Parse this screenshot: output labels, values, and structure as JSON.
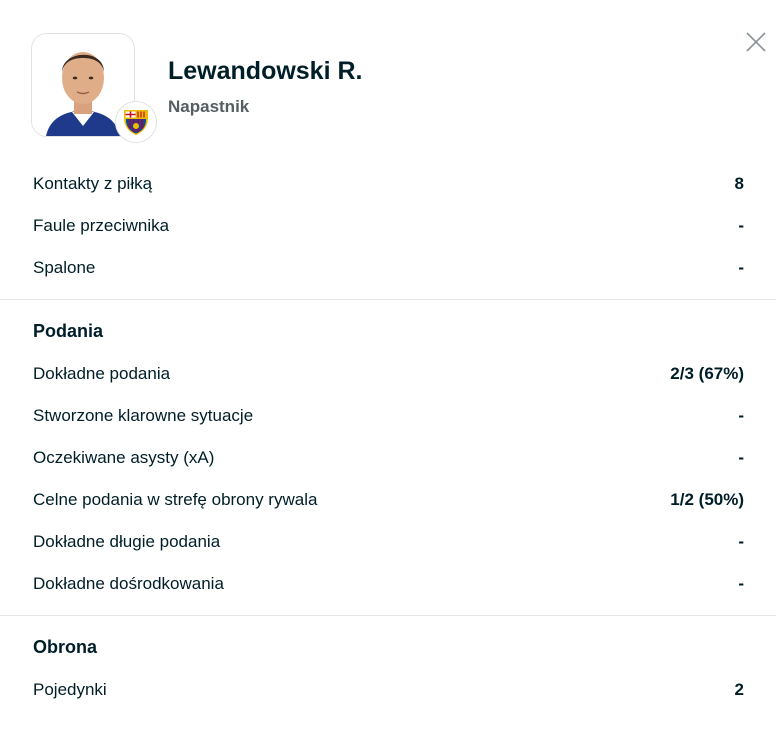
{
  "player": {
    "name": "Lewandowski R.",
    "position": "Napastnik",
    "club_badge_icon": "fc-barcelona-badge-icon"
  },
  "general": [
    {
      "label": "Kontakty z piłką",
      "value": "8"
    },
    {
      "label": "Faule przeciwnika",
      "value": "-"
    },
    {
      "label": "Spalone",
      "value": "-"
    }
  ],
  "passes": {
    "title": "Podania",
    "rows": [
      {
        "label": "Dokładne podania",
        "value": "2/3 (67%)"
      },
      {
        "label": "Stworzone klarowne sytuacje",
        "value": "-"
      },
      {
        "label": "Oczekiwane asysty (xA)",
        "value": "-"
      },
      {
        "label": "Celne podania w strefę obrony rywala",
        "value": "1/2 (50%)"
      },
      {
        "label": "Dokładne długie podania",
        "value": "-"
      },
      {
        "label": "Dokładne dośrodkowania",
        "value": "-"
      }
    ]
  },
  "defense": {
    "title": "Obrona",
    "rows": [
      {
        "label": "Pojedynki",
        "value": "2"
      }
    ]
  },
  "colors": {
    "text": "#001e28",
    "secondary_text": "#555e61",
    "divider": "#e4e7e9",
    "club_blue": "#004d98",
    "club_red": "#a50044",
    "club_gold": "#edbb00"
  }
}
